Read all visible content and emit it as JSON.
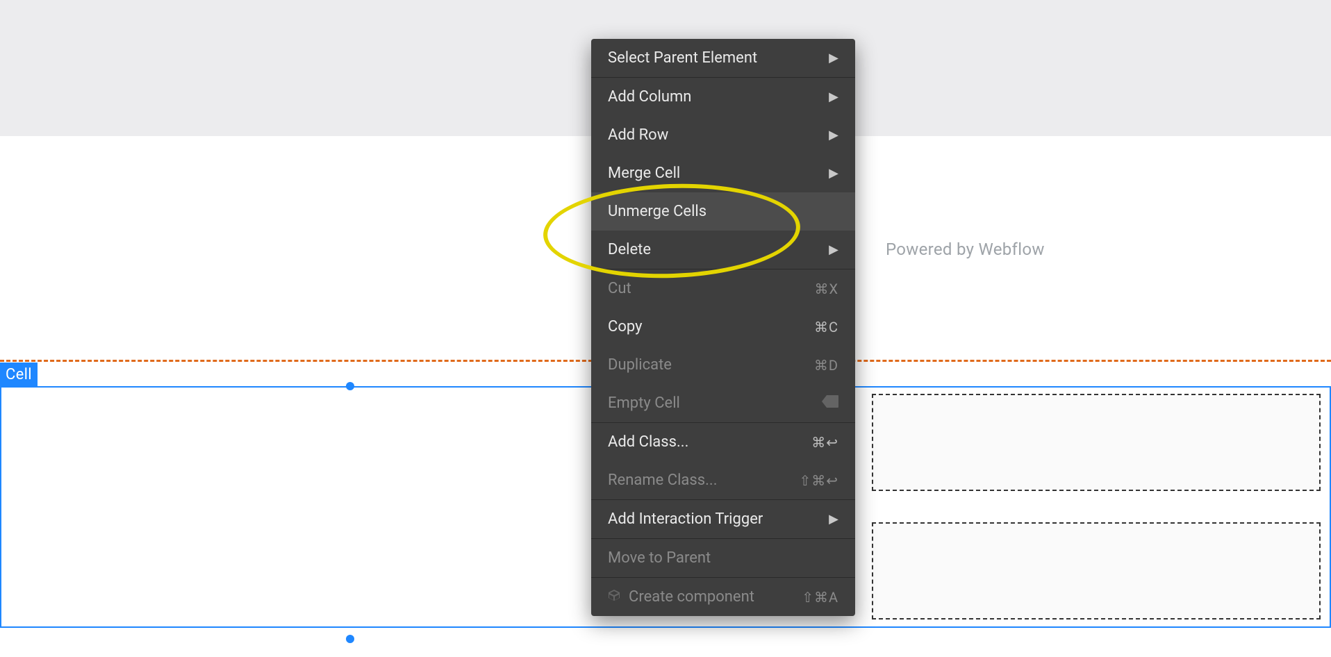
{
  "canvas": {
    "selection_label": "Cell",
    "powered_text": "Powered by Webflow"
  },
  "context_menu": {
    "items": [
      {
        "label": "Select Parent Element",
        "type": "submenu",
        "enabled": true
      },
      {
        "type": "separator"
      },
      {
        "label": "Add Column",
        "type": "submenu",
        "enabled": true
      },
      {
        "label": "Add Row",
        "type": "submenu",
        "enabled": true
      },
      {
        "label": "Merge Cell",
        "type": "submenu",
        "enabled": true
      },
      {
        "label": "Unmerge Cells",
        "type": "action",
        "enabled": true,
        "highlighted": true
      },
      {
        "label": "Delete",
        "type": "submenu",
        "enabled": true
      },
      {
        "type": "separator"
      },
      {
        "label": "Cut",
        "type": "action",
        "shortcut": "⌘X",
        "enabled": false
      },
      {
        "label": "Copy",
        "type": "action",
        "shortcut": "⌘C",
        "enabled": true
      },
      {
        "label": "Duplicate",
        "type": "action",
        "shortcut": "⌘D",
        "enabled": false
      },
      {
        "label": "Empty Cell",
        "type": "action",
        "icon": "backspace",
        "enabled": false
      },
      {
        "type": "separator"
      },
      {
        "label": "Add Class...",
        "type": "action",
        "shortcut": "⌘↩",
        "enabled": true
      },
      {
        "label": "Rename Class...",
        "type": "action",
        "shortcut": "⇧⌘↩",
        "enabled": false
      },
      {
        "type": "separator"
      },
      {
        "label": "Add Interaction Trigger",
        "type": "submenu",
        "enabled": true
      },
      {
        "type": "separator"
      },
      {
        "label": "Move to Parent",
        "type": "action",
        "enabled": false
      },
      {
        "type": "separator"
      },
      {
        "label": "Create component",
        "type": "action",
        "shortcut": "⇧⌘A",
        "enabled": false,
        "icon": "cube"
      }
    ]
  }
}
